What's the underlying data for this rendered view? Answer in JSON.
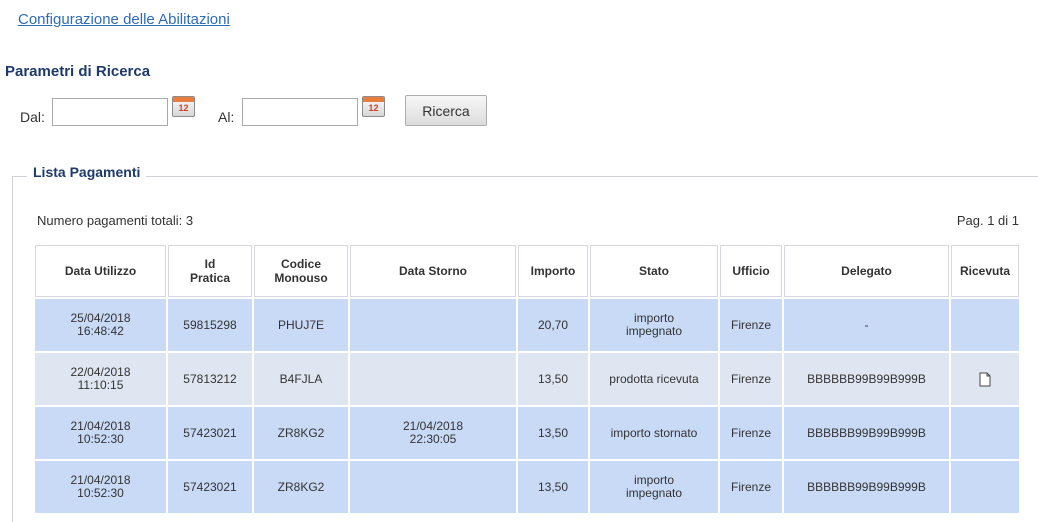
{
  "header_link": {
    "label": "Configurazione delle Abilitazioni"
  },
  "search": {
    "title": "Parametri di Ricerca",
    "dal_label": "Dal:",
    "dal_value": "",
    "al_label": "Al:",
    "al_value": "",
    "calendar_icon": "calendar-icon",
    "calendar_icon_day": "12",
    "submit_label": "Ricerca"
  },
  "payments": {
    "legend": "Lista Pagamenti",
    "total_label": "Numero pagamenti totali:",
    "total_count": "3",
    "pagination": "Pag. 1 di 1",
    "columns": [
      "Data Utilizzo",
      "Id Pratica",
      "Codice Monouso",
      "Data Storno",
      "Importo",
      "Stato",
      "Ufficio",
      "Delegato",
      "Ricevuta"
    ],
    "rows": [
      {
        "data_utilizzo": "25/04/2018 16:48:42",
        "id_pratica": "59815298",
        "codice_monouso": "PHUJ7E",
        "data_storno": "",
        "importo": "20,70",
        "stato": "importo impegnato",
        "ufficio": "Firenze",
        "delegato": "-",
        "ricevuta_icon": null
      },
      {
        "data_utilizzo": "22/04/2018 11:10:15",
        "id_pratica": "57813212",
        "codice_monouso": "B4FJLA",
        "data_storno": "",
        "importo": "13,50",
        "stato": "prodotta ricevuta",
        "ufficio": "Firenze",
        "delegato": "BBBBBB99B99B999B",
        "ricevuta_icon": "document-icon"
      },
      {
        "data_utilizzo": "21/04/2018 10:52:30",
        "id_pratica": "57423021",
        "codice_monouso": "ZR8KG2",
        "data_storno": "21/04/2018 22:30:05",
        "importo": "13,50",
        "stato": "importo stornato",
        "ufficio": "Firenze",
        "delegato": "BBBBBB99B99B999B",
        "ricevuta_icon": null
      },
      {
        "data_utilizzo": "21/04/2018 10:52:30",
        "id_pratica": "57423021",
        "codice_monouso": "ZR8KG2",
        "data_storno": "",
        "importo": "13,50",
        "stato": "importo impegnato",
        "ufficio": "Firenze",
        "delegato": "BBBBBB99B99B999B",
        "ricevuta_icon": null
      }
    ]
  },
  "colors": {
    "link": "#2d6bb5",
    "heading": "#1e3a6b",
    "row_bg": "#c8daf6",
    "row_alt_bg": "#dfe6f1",
    "calendar_accent": "#e87d3e",
    "calendar_day": "#d3432b"
  }
}
